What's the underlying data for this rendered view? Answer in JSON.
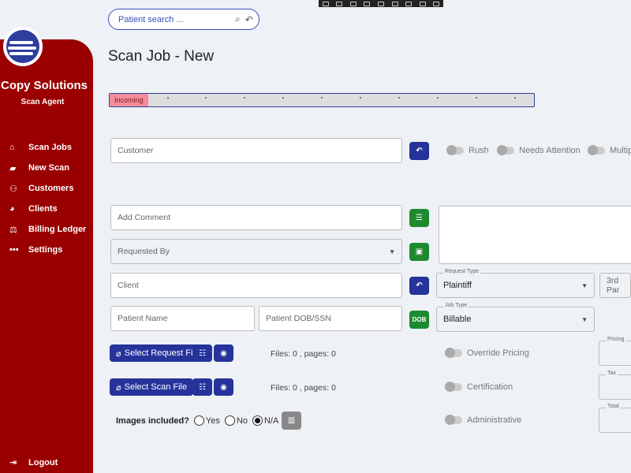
{
  "app": {
    "brand_title": "Copy Solutions",
    "brand_subtitle": "Scan Agent",
    "page_title": "Scan Job - New"
  },
  "sidebar": {
    "items": [
      {
        "label": "Scan Jobs",
        "icon": "home-icon"
      },
      {
        "label": "New Scan",
        "icon": "scanner-icon"
      },
      {
        "label": "Customers",
        "icon": "users-icon"
      },
      {
        "label": "Clients",
        "icon": "clients-icon"
      },
      {
        "label": "Billing Ledger",
        "icon": "ledger-icon"
      },
      {
        "label": "Settings",
        "icon": "more-icon"
      }
    ],
    "logout_label": "Logout"
  },
  "search": {
    "placeholder": "Patient search ..."
  },
  "progress": {
    "current_step": "Incoming",
    "steps_total": 10,
    "current_index": 1
  },
  "form": {
    "customer_placeholder": "Customer",
    "toggles": [
      "Rush",
      "Needs Attention",
      "Multip"
    ],
    "comment_placeholder": "Add Comment",
    "requested_by_placeholder": "Requested By",
    "client_placeholder": "Client",
    "request_type": {
      "label": "Request Type",
      "value": "Plaintiff"
    },
    "third_party_placeholder": "3rd Par",
    "patient_name_placeholder": "Patient Name",
    "patient_dob_placeholder": "Patient DOB/SSN",
    "dob_button": "DOB",
    "job_type": {
      "label": "Job Type",
      "value": "Billable"
    },
    "select_request_file": "Select Request File",
    "select_scan_file": "Select Scan File",
    "request_files_info": "Files: 0 , pages: 0",
    "scan_files_info": "Files: 0 , pages: 0",
    "override_pricing": "Override Pricing",
    "certification": "Certification",
    "administrative": "Administrative",
    "pricing_label": "Pricing",
    "tax_label": "Tax",
    "total_label": "Total",
    "images_included_label": "Images included?",
    "images_options": [
      "Yes",
      "No",
      "N/A"
    ],
    "images_selected": "N/A"
  },
  "colors": {
    "sidebar": "#9b0000",
    "primary": "#25339b",
    "success": "#1e8a30",
    "progress_active": "#f58c9c"
  }
}
